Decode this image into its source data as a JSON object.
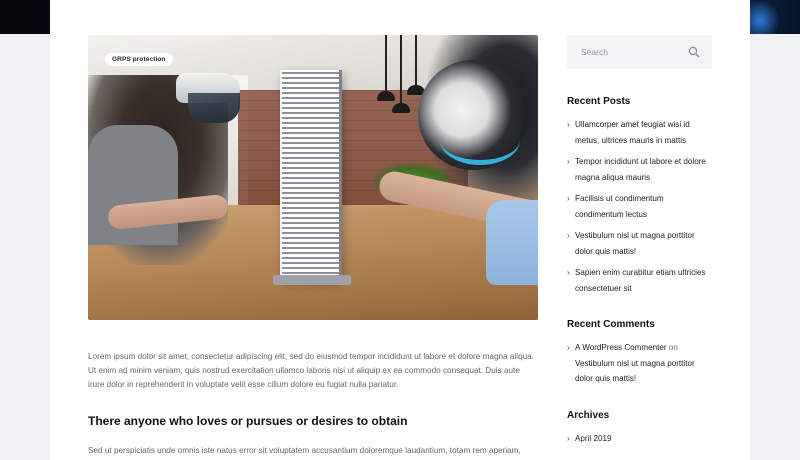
{
  "featured_image": {
    "badge": "GRPS protection"
  },
  "post": {
    "excerpt": "Lorem ipsum dolor sit amet, consectetur adipiscing elit, sed do eiusmod tempor incididunt ut labore et dolore magna aliqua. Ut enim ad minim veniam, quis nostrud exercitation ullamco laboris nisi ut aliquip ex ea commodo consequat. Duis aute irure dolor in reprehenderit in voluptate velit esse cillum dolore eu fugiat nulla pariatur.",
    "section_heading": "There anyone who loves or pursues or desires to obtain",
    "section_excerpt": "Sed ut perspiciatis unde omnis iste natus error sit voluptatem accusantium doloremque laudantium, totam rem aperiam,"
  },
  "sidebar": {
    "search": {
      "placeholder": "Search",
      "icon": "search-icon"
    },
    "recent_posts": {
      "title": "Recent Posts",
      "items": [
        "Ullamcorper amet feugiat wisi id metus, ultrices mauris in mattis",
        "Tempor incididunt ut labore et dolore magna aliqua mauris",
        "Facilisis ut condimentum condimentum lectus",
        "Vestibulum nisl ut magna porttitor dolor quis mattis!",
        "Sapien enim curabitur etiam ultricies consectetuer sit"
      ]
    },
    "recent_comments": {
      "title": "Recent Comments",
      "author": "A WordPress Commenter",
      "on": "on",
      "post": "Vestibulum nisl ut magna porttitor dolor quis mattis!"
    },
    "archives": {
      "title": "Archives",
      "items": [
        "April 2019"
      ]
    }
  }
}
